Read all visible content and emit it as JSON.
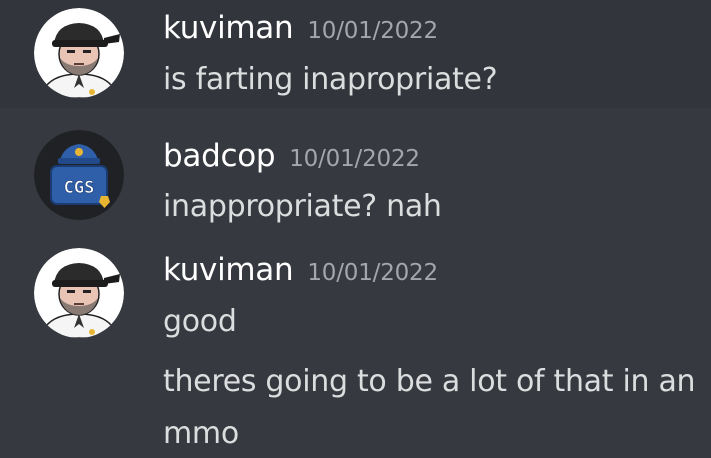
{
  "messages": [
    {
      "username": "kuviman",
      "timestamp": "10/01/2022",
      "lines": [
        "is farting inapropriate?"
      ]
    },
    {
      "username": "badcop",
      "timestamp": "10/01/2022",
      "avatar_text": "CGS",
      "lines": [
        "inappropriate? nah"
      ]
    },
    {
      "username": "kuviman",
      "timestamp": "10/01/2022",
      "lines": [
        "good",
        "theres going to be a lot of that in an",
        "mmo"
      ]
    }
  ],
  "colors": {
    "background": "#36393f",
    "highlight_row": "#32353b",
    "username": "#ffffff",
    "timestamp": "#a3a6aa",
    "message_text": "#dcddde",
    "cop_avatar": "#2f5fa8"
  },
  "icons": {
    "kuviman_avatar": "cartoon-man-with-cap-icon",
    "badcop_avatar": "police-badge-icon"
  }
}
